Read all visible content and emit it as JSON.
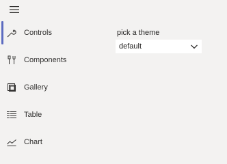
{
  "nav": {
    "items": [
      {
        "label": "Controls",
        "icon": "wrench-icon",
        "selected": true
      },
      {
        "label": "Components",
        "icon": "tools-icon",
        "selected": false
      },
      {
        "label": "Gallery",
        "icon": "gallery-icon",
        "selected": false
      },
      {
        "label": "Table",
        "icon": "table-icon",
        "selected": false
      },
      {
        "label": "Chart",
        "icon": "chart-icon",
        "selected": false
      }
    ]
  },
  "theme": {
    "label": "pick a theme",
    "selected": "default"
  },
  "colors": {
    "background": "#f3f2f1",
    "selected_indicator": "#5c6bc0",
    "dropdown_background": "#ffffff"
  }
}
